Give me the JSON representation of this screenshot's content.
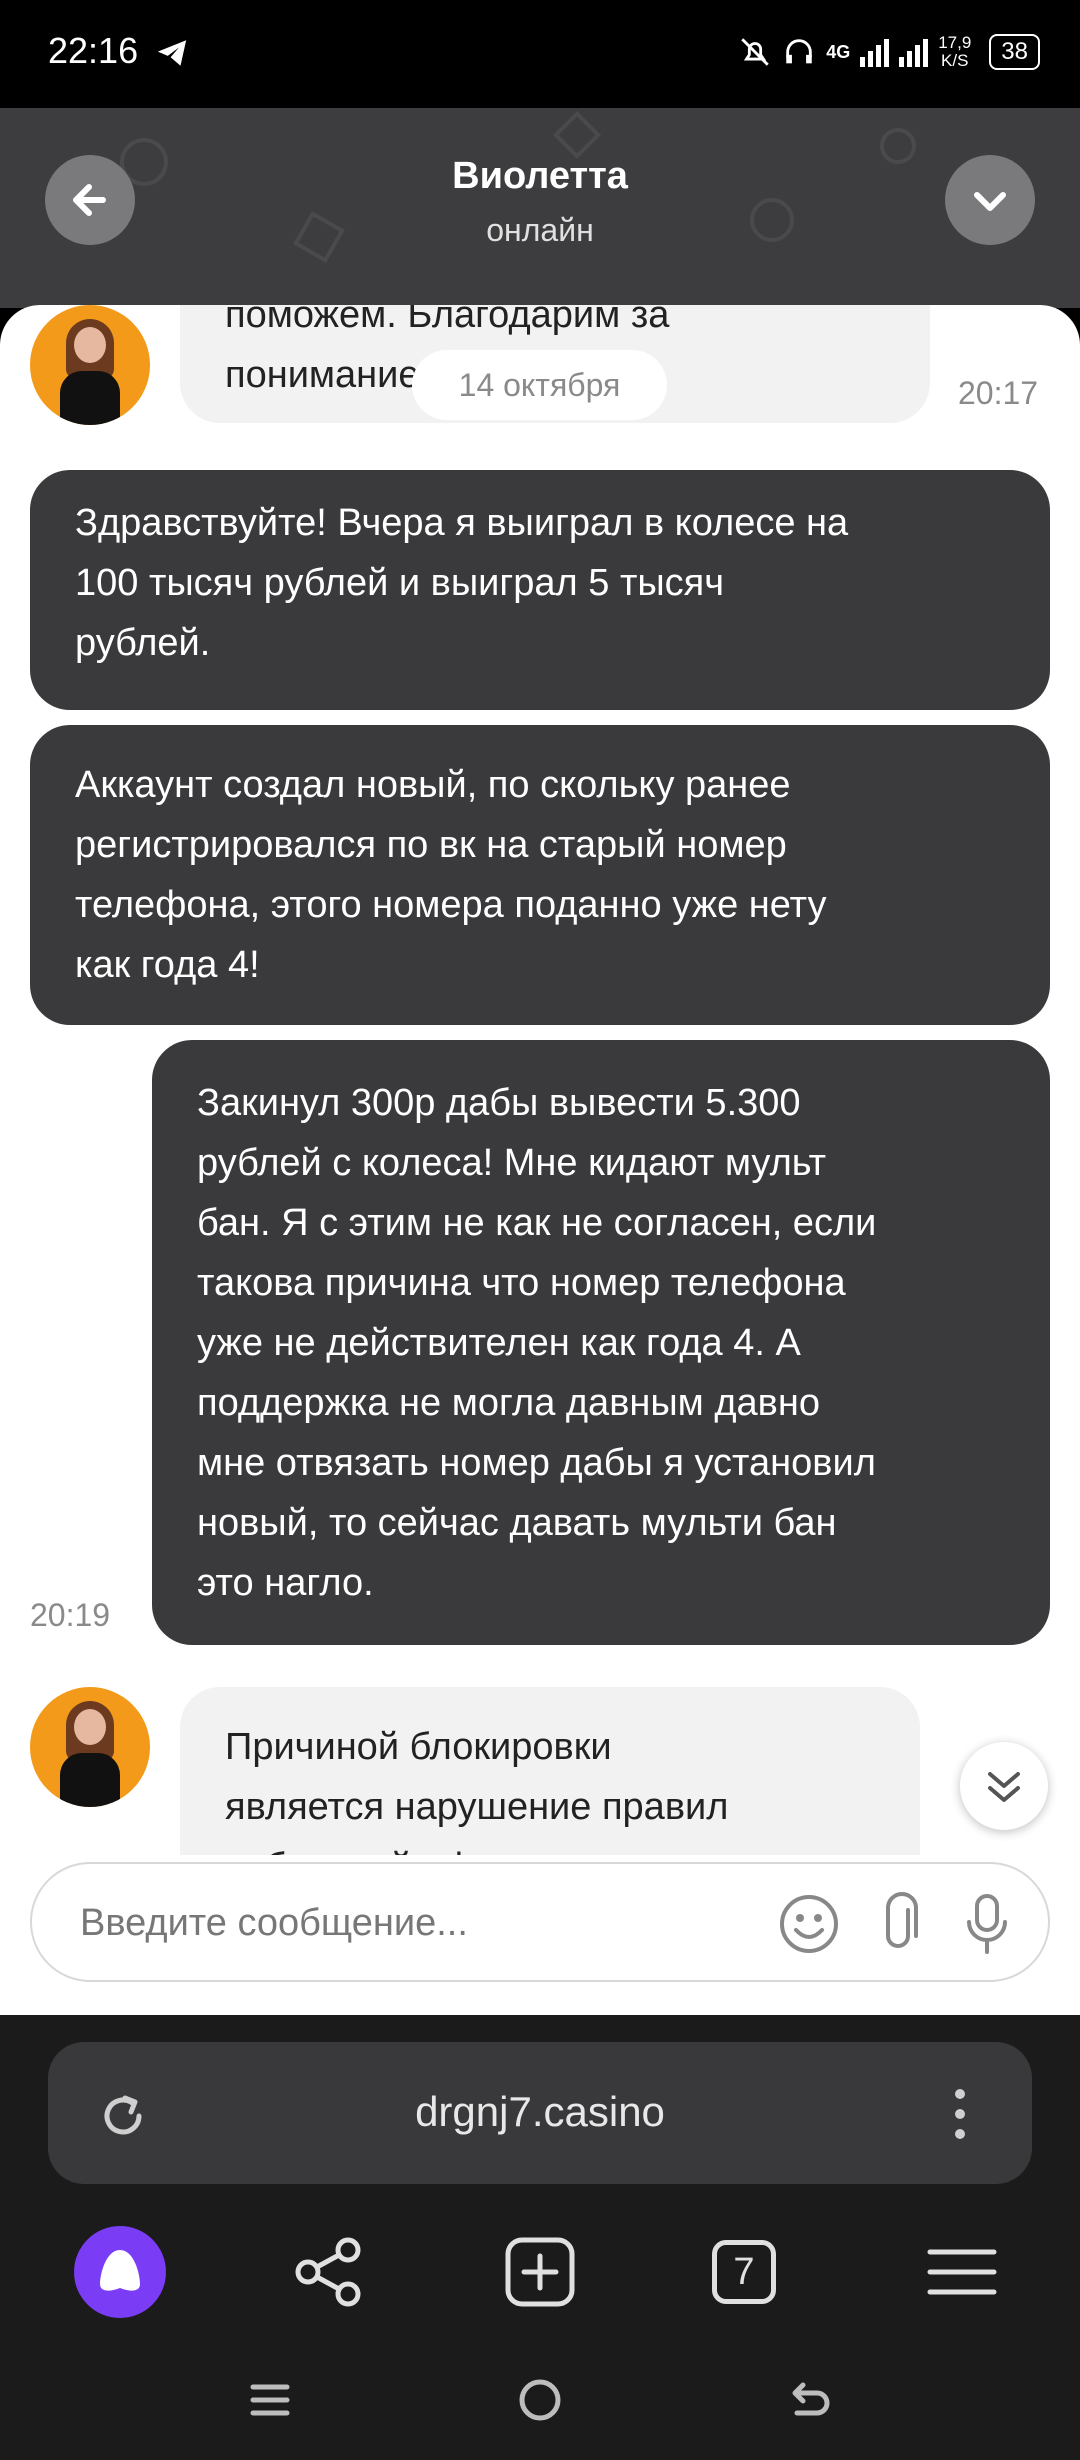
{
  "status_bar": {
    "time": "22:16",
    "network": "4G",
    "speed_value": "17,9",
    "speed_unit": "K/S",
    "battery": "38"
  },
  "header": {
    "contact_name": "Виолетта",
    "contact_status": "онлайн"
  },
  "chat": {
    "date_separator": "14 октября",
    "messages": [
      {
        "direction": "incoming",
        "text_lines": [
          "поможем. Благодарим за",
          "понимание!"
        ],
        "time": "20:17"
      },
      {
        "direction": "outgoing",
        "text_lines": [
          "Здравствуйте! Вчера я выиграл в колесе на",
          "100 тысяч рублей и выиграл 5 тысяч",
          "рублей."
        ]
      },
      {
        "direction": "outgoing",
        "text_lines": [
          "Аккаунт создал новый, по скольку ранее",
          "регистрировался по вк на старый номер",
          "телефона, этого номера поданно уже нету",
          "как года 4!"
        ]
      },
      {
        "direction": "outgoing",
        "text_lines": [
          "Закинул 300р дабы вывести 5.300",
          "рублей с колеса! Мне кидают мульт",
          "бан. Я с этим не как не согласен, если",
          "такова причина что номер телефона",
          "уже не действителен как года 4. А",
          "поддержка не могла давным давно",
          "мне отвязать номер дабы я установил",
          "новый, то сейчас давать мульти бан",
          "это нагло."
        ],
        "time": "20:19"
      },
      {
        "direction": "incoming",
        "text_lines": [
          "Причиной блокировки",
          "является нарушение правил",
          "публичной оферты, а именно"
        ]
      }
    ]
  },
  "composer": {
    "placeholder": "Введите сообщение..."
  },
  "browser": {
    "url": "drgnj7.casino",
    "tabs_count": "7"
  },
  "colors": {
    "header_bg": "#3d3d3f",
    "outgoing_bubble": "#3a3a3c",
    "incoming_bubble": "#f2f2f2",
    "alice_accent": "#7b3cf5"
  }
}
